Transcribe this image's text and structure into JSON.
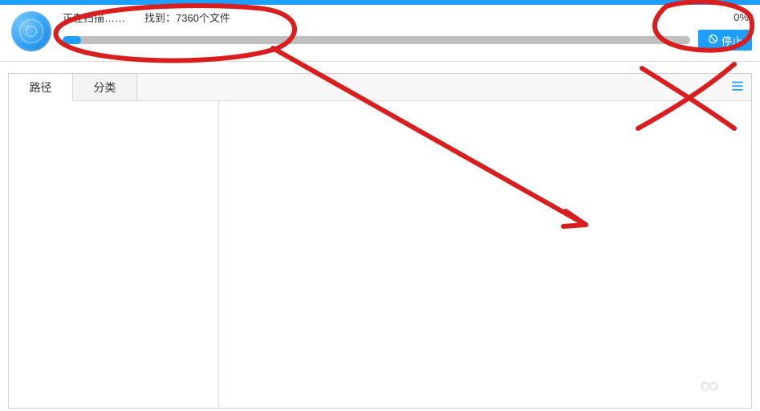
{
  "header": {
    "scanning_label": "正在扫描……",
    "found_label": "找到：7360个文件",
    "percent_label": "0%",
    "stop_label": "停止"
  },
  "tabs": {
    "path": "路径",
    "category": "分类"
  },
  "icons": {
    "stop": "stop-circle-icon",
    "menu": "hamburger-icon",
    "logo": "radar-logo-icon"
  }
}
